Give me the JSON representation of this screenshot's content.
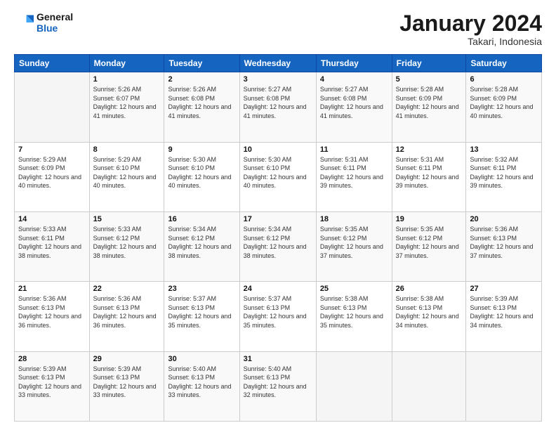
{
  "header": {
    "logo_line1": "General",
    "logo_line2": "Blue",
    "month": "January 2024",
    "location": "Takari, Indonesia"
  },
  "weekdays": [
    "Sunday",
    "Monday",
    "Tuesday",
    "Wednesday",
    "Thursday",
    "Friday",
    "Saturday"
  ],
  "weeks": [
    [
      {
        "day": "",
        "sunrise": "",
        "sunset": "",
        "daylight": ""
      },
      {
        "day": "1",
        "sunrise": "5:26 AM",
        "sunset": "6:07 PM",
        "daylight": "12 hours and 41 minutes."
      },
      {
        "day": "2",
        "sunrise": "5:26 AM",
        "sunset": "6:08 PM",
        "daylight": "12 hours and 41 minutes."
      },
      {
        "day": "3",
        "sunrise": "5:27 AM",
        "sunset": "6:08 PM",
        "daylight": "12 hours and 41 minutes."
      },
      {
        "day": "4",
        "sunrise": "5:27 AM",
        "sunset": "6:08 PM",
        "daylight": "12 hours and 41 minutes."
      },
      {
        "day": "5",
        "sunrise": "5:28 AM",
        "sunset": "6:09 PM",
        "daylight": "12 hours and 41 minutes."
      },
      {
        "day": "6",
        "sunrise": "5:28 AM",
        "sunset": "6:09 PM",
        "daylight": "12 hours and 40 minutes."
      }
    ],
    [
      {
        "day": "7",
        "sunrise": "5:29 AM",
        "sunset": "6:09 PM",
        "daylight": "12 hours and 40 minutes."
      },
      {
        "day": "8",
        "sunrise": "5:29 AM",
        "sunset": "6:10 PM",
        "daylight": "12 hours and 40 minutes."
      },
      {
        "day": "9",
        "sunrise": "5:30 AM",
        "sunset": "6:10 PM",
        "daylight": "12 hours and 40 minutes."
      },
      {
        "day": "10",
        "sunrise": "5:30 AM",
        "sunset": "6:10 PM",
        "daylight": "12 hours and 40 minutes."
      },
      {
        "day": "11",
        "sunrise": "5:31 AM",
        "sunset": "6:11 PM",
        "daylight": "12 hours and 39 minutes."
      },
      {
        "day": "12",
        "sunrise": "5:31 AM",
        "sunset": "6:11 PM",
        "daylight": "12 hours and 39 minutes."
      },
      {
        "day": "13",
        "sunrise": "5:32 AM",
        "sunset": "6:11 PM",
        "daylight": "12 hours and 39 minutes."
      }
    ],
    [
      {
        "day": "14",
        "sunrise": "5:33 AM",
        "sunset": "6:11 PM",
        "daylight": "12 hours and 38 minutes."
      },
      {
        "day": "15",
        "sunrise": "5:33 AM",
        "sunset": "6:12 PM",
        "daylight": "12 hours and 38 minutes."
      },
      {
        "day": "16",
        "sunrise": "5:34 AM",
        "sunset": "6:12 PM",
        "daylight": "12 hours and 38 minutes."
      },
      {
        "day": "17",
        "sunrise": "5:34 AM",
        "sunset": "6:12 PM",
        "daylight": "12 hours and 38 minutes."
      },
      {
        "day": "18",
        "sunrise": "5:35 AM",
        "sunset": "6:12 PM",
        "daylight": "12 hours and 37 minutes."
      },
      {
        "day": "19",
        "sunrise": "5:35 AM",
        "sunset": "6:12 PM",
        "daylight": "12 hours and 37 minutes."
      },
      {
        "day": "20",
        "sunrise": "5:36 AM",
        "sunset": "6:13 PM",
        "daylight": "12 hours and 37 minutes."
      }
    ],
    [
      {
        "day": "21",
        "sunrise": "5:36 AM",
        "sunset": "6:13 PM",
        "daylight": "12 hours and 36 minutes."
      },
      {
        "day": "22",
        "sunrise": "5:36 AM",
        "sunset": "6:13 PM",
        "daylight": "12 hours and 36 minutes."
      },
      {
        "day": "23",
        "sunrise": "5:37 AM",
        "sunset": "6:13 PM",
        "daylight": "12 hours and 35 minutes."
      },
      {
        "day": "24",
        "sunrise": "5:37 AM",
        "sunset": "6:13 PM",
        "daylight": "12 hours and 35 minutes."
      },
      {
        "day": "25",
        "sunrise": "5:38 AM",
        "sunset": "6:13 PM",
        "daylight": "12 hours and 35 minutes."
      },
      {
        "day": "26",
        "sunrise": "5:38 AM",
        "sunset": "6:13 PM",
        "daylight": "12 hours and 34 minutes."
      },
      {
        "day": "27",
        "sunrise": "5:39 AM",
        "sunset": "6:13 PM",
        "daylight": "12 hours and 34 minutes."
      }
    ],
    [
      {
        "day": "28",
        "sunrise": "5:39 AM",
        "sunset": "6:13 PM",
        "daylight": "12 hours and 33 minutes."
      },
      {
        "day": "29",
        "sunrise": "5:39 AM",
        "sunset": "6:13 PM",
        "daylight": "12 hours and 33 minutes."
      },
      {
        "day": "30",
        "sunrise": "5:40 AM",
        "sunset": "6:13 PM",
        "daylight": "12 hours and 33 minutes."
      },
      {
        "day": "31",
        "sunrise": "5:40 AM",
        "sunset": "6:13 PM",
        "daylight": "12 hours and 32 minutes."
      },
      {
        "day": "",
        "sunrise": "",
        "sunset": "",
        "daylight": ""
      },
      {
        "day": "",
        "sunrise": "",
        "sunset": "",
        "daylight": ""
      },
      {
        "day": "",
        "sunrise": "",
        "sunset": "",
        "daylight": ""
      }
    ]
  ],
  "labels": {
    "sunrise_prefix": "Sunrise: ",
    "sunset_prefix": "Sunset: ",
    "daylight_prefix": "Daylight: "
  }
}
